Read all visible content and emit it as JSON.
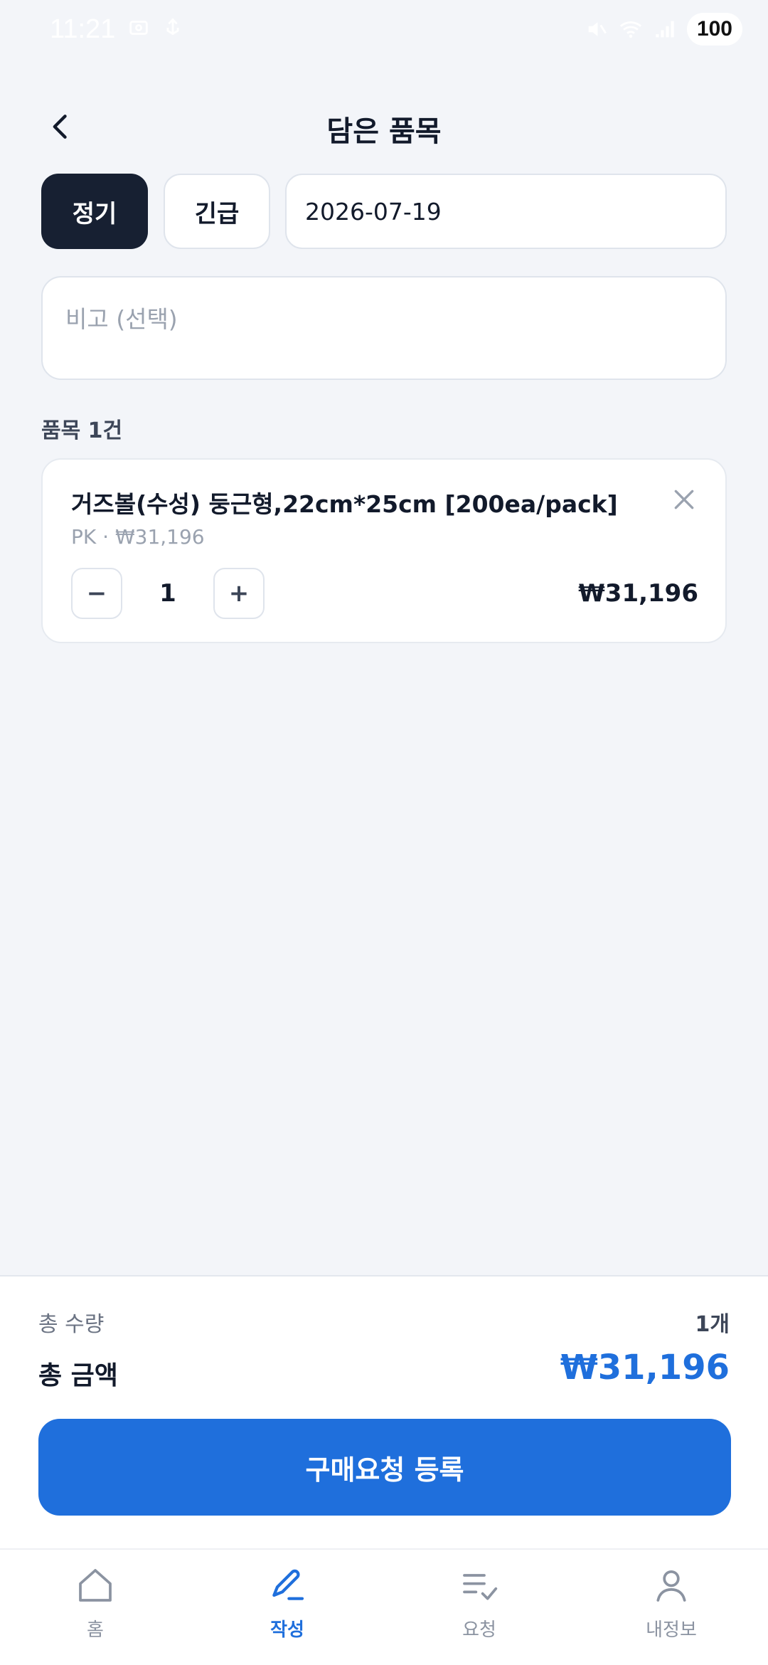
{
  "status_bar": {
    "time": "11:21",
    "battery": "100"
  },
  "header": {
    "title": "담은 품목"
  },
  "request_type": {
    "regular_label": "정기",
    "urgent_label": "긴급",
    "selected": "정기"
  },
  "date_field": {
    "value": "2026-07-19"
  },
  "memo_field": {
    "placeholder": "비고 (선택)"
  },
  "items_section": {
    "count_label": "품목 1건",
    "items": [
      {
        "name": "거즈볼(수성) 둥근형,22cm*25cm [200ea/pack]",
        "sub": "PK · ₩31,196",
        "quantity": "1",
        "minus_label": "−",
        "plus_label": "+",
        "total": "₩31,196"
      }
    ]
  },
  "summary": {
    "qty_label": "총 수량",
    "qty_value": "1개",
    "amount_label": "총 금액",
    "amount_value": "₩31,196",
    "submit_label": "구매요청 등록"
  },
  "bottom_nav": {
    "items": [
      {
        "label": "홈",
        "icon": "home-icon"
      },
      {
        "label": "작성",
        "icon": "pencil-icon"
      },
      {
        "label": "요청",
        "icon": "list-check-icon"
      },
      {
        "label": "내정보",
        "icon": "user-icon"
      }
    ],
    "active": "작성"
  },
  "colors": {
    "accent": "#1f6fdc",
    "dark": "#172032",
    "background": "#f3f5f9"
  }
}
